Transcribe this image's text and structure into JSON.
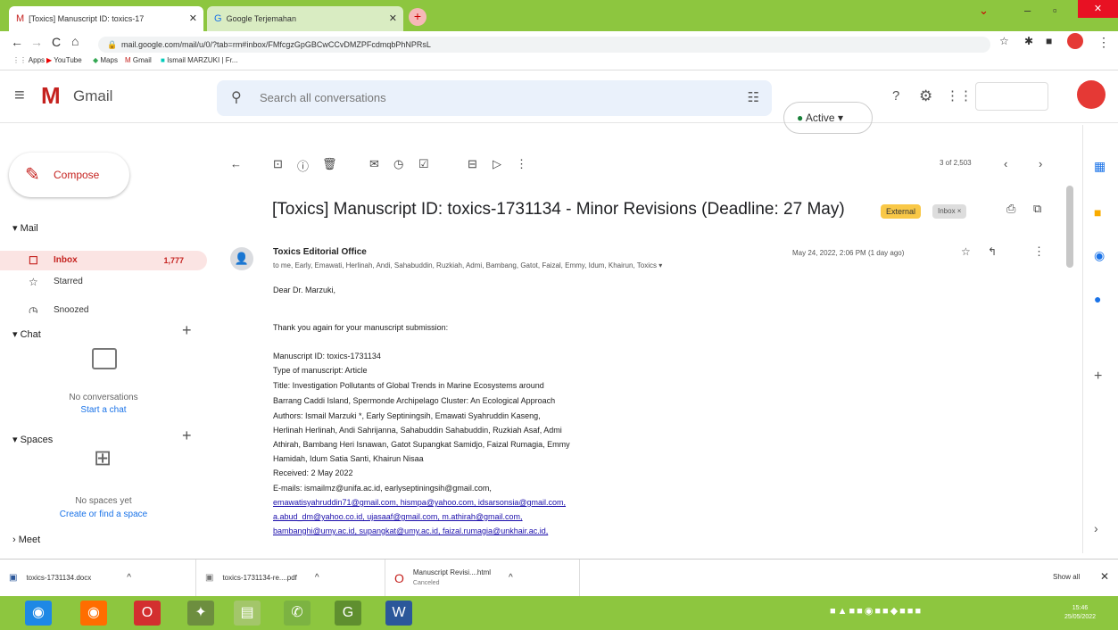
{
  "browser": {
    "tabs": [
      {
        "icon": "gmail-icon",
        "title": "[Toxics] Manuscript ID: toxics-17",
        "active": true
      },
      {
        "icon": "translate-icon",
        "title": "Google Terjemahan",
        "active": false
      }
    ],
    "url": "mail.google.com/mail/u/0/?tab=rm#inbox/FMfcgzGpGBCwCCvDMZPFcdmqbPhNPRsL",
    "bookmarks": [
      "Apps",
      "YouTube",
      "Maps",
      "Gmail",
      "Ismail MARZUKI | Fr..."
    ]
  },
  "gmail": {
    "logo_text": "Gmail",
    "search_placeholder": "Search all conversations",
    "status_chip": "Active",
    "compose_label": "Compose",
    "sections": {
      "mail": "Mail",
      "chat": "Chat",
      "spaces": "Spaces",
      "meet": "Meet"
    },
    "nav": [
      {
        "label": "Inbox",
        "count": "1,777",
        "icon": "inbox-icon"
      },
      {
        "label": "Starred",
        "count": "",
        "icon": "star-icon"
      },
      {
        "label": "Snoozed",
        "count": "",
        "icon": "clock-icon"
      }
    ],
    "chat_empty": "No conversations",
    "chat_link": "Start a chat",
    "spaces_empty": "No spaces yet",
    "spaces_link": "Create or find a space"
  },
  "message": {
    "pager": "3 of 2,503",
    "subject": "[Toxics] Manuscript ID: toxics-1731134 - Minor Revisions (Deadline: 27 May)",
    "external_badge": "External",
    "inbox_badge": "Inbox ×",
    "sender": "Toxics Editorial Office",
    "recipients": "to me, Early, Emawati, Herlinah, Andi, Sahabuddin, Ruzkiah, Admi, Bambang, Gatot, Faizal, Emmy, Idum, Khairun, Toxics ▾",
    "date": "May 24, 2022, 2:06 PM (1 day ago)",
    "body": [
      "Dear Dr. Marzuki,",
      "",
      "Thank you again for your manuscript submission:",
      "",
      "Manuscript ID: toxics-1731134",
      "Type of manuscript: Article",
      "Title: Investigation Pollutants of Global Trends in Marine Ecosystems around",
      "Barrang Caddi Island, Spermonde Archipelago Cluster: An Ecological Approach",
      "Authors: Ismail Marzuki *, Early Septiningsih, Emawati Syahruddin Kaseng,",
      "Herlinah Herlinah, Andi Sahrijanna, Sahabuddin Sahabuddin, Ruzkiah Asaf, Admi",
      "Athirah, Bambang Heri Isnawan, Gatot Supangkat Samidjo, Faizal Rumagia, Emmy",
      "Hamidah, Idum Satia Santi, Khairun Nisaa",
      "Received: 2 May 2022"
    ],
    "email_lines": [
      "E-mails: ismailmz@unifa.ac.id, earlyseptiningsih@gmail.com,",
      "emawatisyahruddin71@gmail.com, hismpa@yahoo.com, idsarsonsia@gmail.com,",
      "a.abud_dm@yahoo.co.id, ujasaaf@gmail.com, m.athirah@gmail.com,",
      "bambanghi@umy.ac.id, supangkat@umy.ac.id, faizal.rumagia@unkhair.ac.id,"
    ]
  },
  "downloads": [
    {
      "name": "toxics-1731134.docx",
      "sub": ""
    },
    {
      "name": "toxics-1731134-re....pdf",
      "sub": ""
    },
    {
      "name": "Manuscript Revisi....html",
      "sub": "Canceled"
    }
  ],
  "downloads_show_all": "Show all",
  "clock": {
    "time": "15:46",
    "date": "25/05/2022"
  }
}
